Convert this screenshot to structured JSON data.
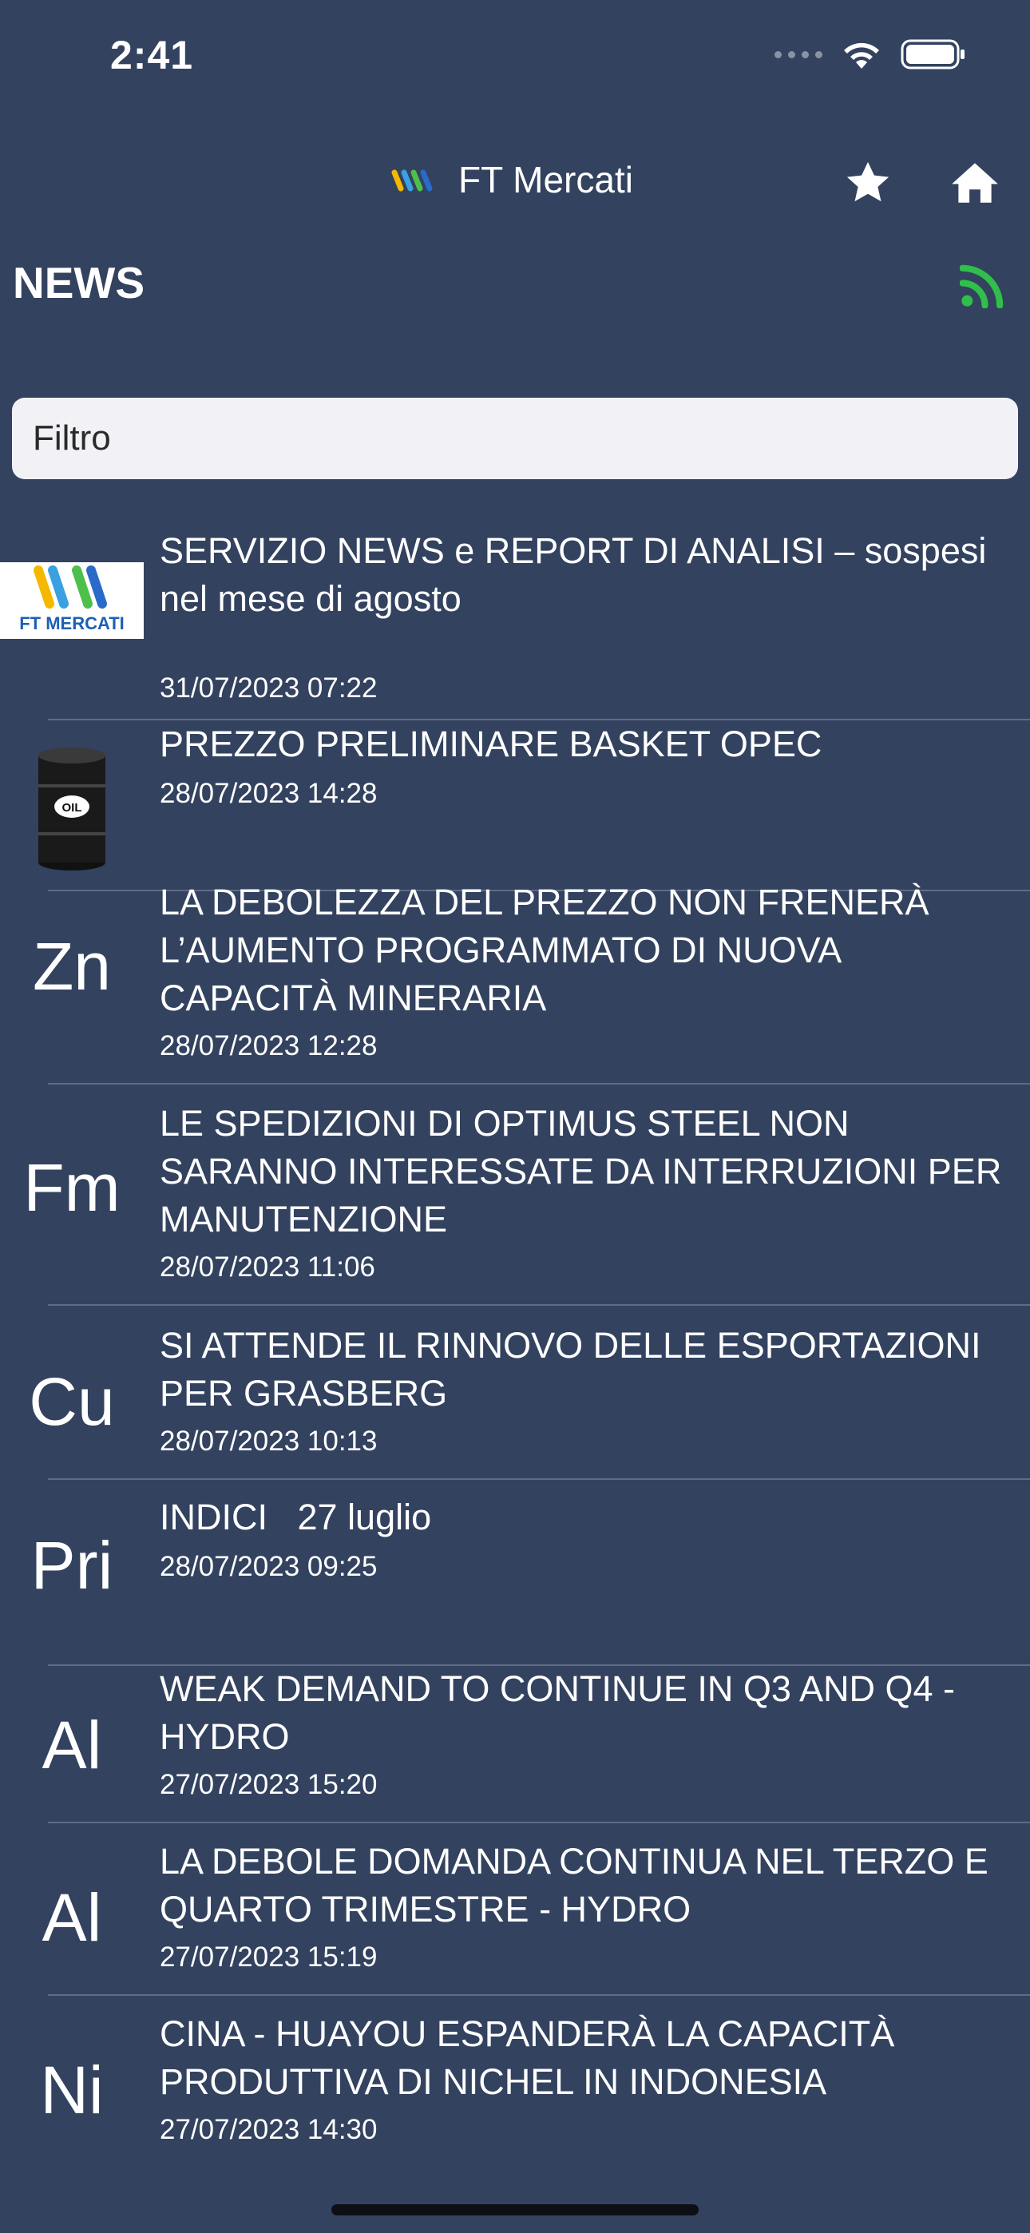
{
  "status": {
    "time": "2:41"
  },
  "nav": {
    "title": "FT Mercati"
  },
  "section": {
    "title": "NEWS"
  },
  "filter": {
    "placeholder": "Filtro",
    "value": ""
  },
  "news": [
    {
      "thumb": "FT MERCATI",
      "title": "SERVIZIO NEWS e REPORT DI ANALISI – sospesi nel mese di agosto",
      "date": "31/07/2023 07:22"
    },
    {
      "thumb": "OIL",
      "title": "PREZZO PRELIMINARE BASKET OPEC",
      "date": "28/07/2023 14:28"
    },
    {
      "thumb": "Zn",
      "title": "LA DEBOLEZZA DEL PREZZO NON FRENERÀ L’AUMENTO PROGRAMMATO DI NUOVA CAPACITÀ MINERARIA",
      "date": "28/07/2023 12:28"
    },
    {
      "thumb": "Fm",
      "title": "LE SPEDIZIONI DI OPTIMUS STEEL NON SARANNO INTERESSATE DA INTERRUZIONI PER MANUTENZIONE",
      "date": "28/07/2023 11:06"
    },
    {
      "thumb": "Cu",
      "title": "SI ATTENDE IL RINNOVO DELLE ESPORTAZIONI PER GRASBERG",
      "date": "28/07/2023 10:13"
    },
    {
      "thumb": "Pri",
      "title": "INDICI   27 luglio",
      "date": "28/07/2023 09:25"
    },
    {
      "thumb": "Al",
      "title": "WEAK DEMAND TO CONTINUE IN Q3 AND Q4 - HYDRO",
      "date": "27/07/2023 15:20"
    },
    {
      "thumb": "Al",
      "title": "LA DEBOLE DOMANDA CONTINUA NEL TERZO E QUARTO TRIMESTRE - HYDRO",
      "date": "27/07/2023 15:19"
    },
    {
      "thumb": "Ni",
      "title": "CINA - HUAYOU ESPANDERÀ LA CAPACITÀ PRODUTTIVA DI NICHEL IN INDONESIA",
      "date": "27/07/2023 14:30"
    }
  ],
  "colors": {
    "background": "#33425f",
    "rss": "#2fbf4a",
    "separator": "#5f6c88"
  },
  "icons": [
    "wifi-icon",
    "battery-icon",
    "star-icon",
    "home-icon",
    "rss-icon",
    "oil-barrel-icon",
    "ft-mercati-logo"
  ]
}
